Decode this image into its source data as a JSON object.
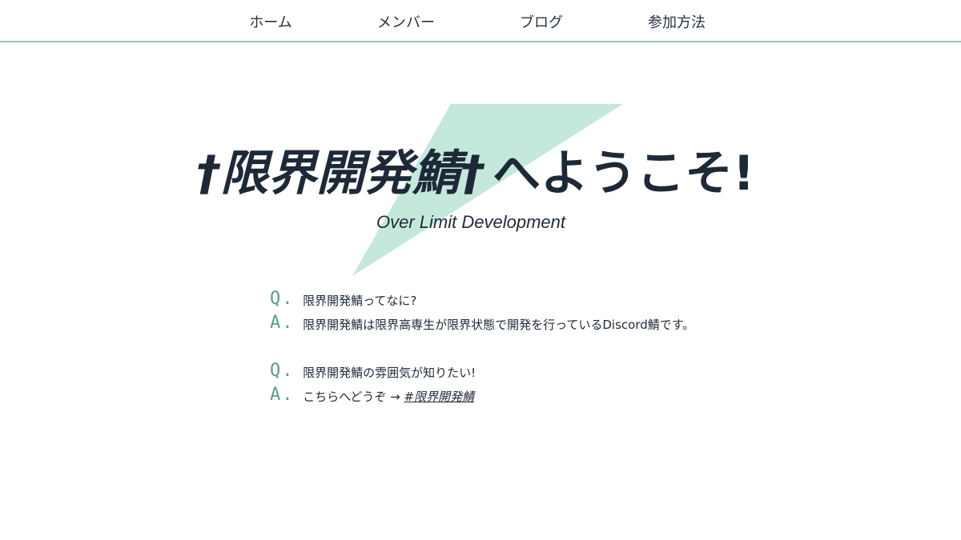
{
  "nav": {
    "items": [
      {
        "label": "ホーム"
      },
      {
        "label": "メンバー"
      },
      {
        "label": "ブログ"
      },
      {
        "label": "参加方法"
      }
    ],
    "border_color": "#8fc8bd"
  },
  "hero": {
    "title_name": "†限界開発鯖†",
    "title_suffix": "へようこそ!",
    "subtitle": "Over Limit Development",
    "accent_color": "#c5e8dc"
  },
  "faq": [
    {
      "q_mark": "Q.",
      "question": "限界開発鯖ってなに?",
      "a_mark": "A.",
      "answer": "限界開発鯖は限界高専生が限界状態で開発を行っているDiscord鯖です。"
    },
    {
      "q_mark": "Q.",
      "question": "限界開発鯖の雰囲気が知りたい!",
      "a_mark": "A.",
      "answer_prefix": "こちらへどうぞ →",
      "answer_link": "#限界開発鯖"
    }
  ],
  "colors": {
    "text": "#1f2a37",
    "mark": "#5d9c90"
  }
}
